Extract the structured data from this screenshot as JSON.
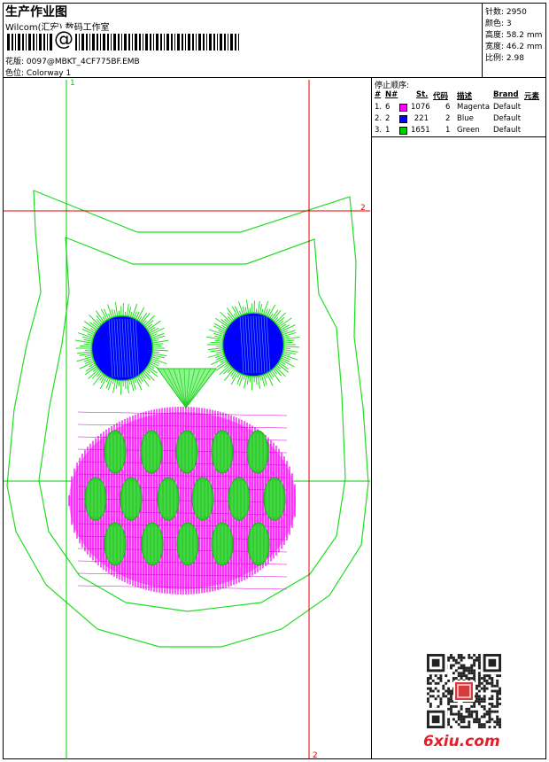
{
  "header": {
    "title": "生产作业图",
    "subtitle": "Wilcom(汇宏) 数码工作室",
    "barcode_symbol": "@",
    "design_label": "花版:",
    "design_value": "0097@MBKT_4CF775BF.EMB",
    "colorway_label": "色位:",
    "colorway_value": "Colorway 1"
  },
  "stats": [
    {
      "label": "针数:",
      "value": "2950"
    },
    {
      "label": "颜色:",
      "value": "3"
    },
    {
      "label": "高度:",
      "value": "58.2 mm"
    },
    {
      "label": "宽度:",
      "value": "46.2 mm"
    },
    {
      "label": "比例:",
      "value": "2.98"
    }
  ],
  "stop_table": {
    "title": "停止顺序:",
    "headers": {
      "stop": "#",
      "needle": "N#",
      "stitches": "St.",
      "code": "代码",
      "description": "描述",
      "brand": "Brand",
      "element": "元素"
    },
    "rows": [
      {
        "stop": "1.",
        "needle": "6",
        "color": "#ff00ff",
        "stitches": "1076",
        "code": "6",
        "description": "Magenta",
        "brand": "Default"
      },
      {
        "stop": "2.",
        "needle": "2",
        "color": "#0000ff",
        "stitches": "221",
        "code": "2",
        "description": "Blue",
        "brand": "Default"
      },
      {
        "stop": "3.",
        "needle": "1",
        "color": "#00cc00",
        "stitches": "1651",
        "code": "1",
        "description": "Green",
        "brand": "Default"
      }
    ]
  },
  "guides": {
    "v1": "1",
    "h2": "2",
    "v2": "2"
  },
  "colors": {
    "outline": "#22dd22",
    "belly": "#ff00ff",
    "eye": "#0000ff",
    "guide_green": "#00cc00",
    "guide_red": "#dd0000"
  },
  "watermark": "6xiu.com"
}
